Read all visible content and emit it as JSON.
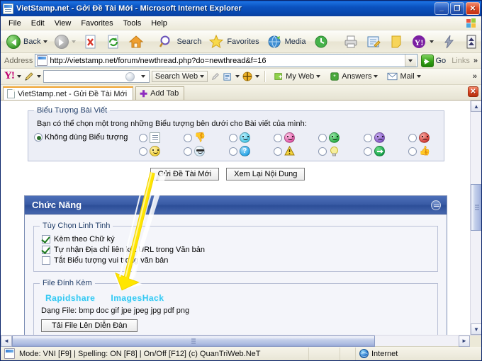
{
  "window": {
    "title": "VietStamp.net - Gởi Đề Tài Mới - Microsoft Internet Explorer",
    "minimize_label": "_",
    "restore_label": "❐",
    "close_label": "✕"
  },
  "menubar": {
    "items": [
      "File",
      "Edit",
      "View",
      "Favorites",
      "Tools",
      "Help"
    ]
  },
  "toolbar": {
    "back_label": "Back",
    "search_label": "Search",
    "favorites_label": "Favorites",
    "media_label": "Media"
  },
  "address": {
    "label": "Address",
    "url": "http://vietstamp.net/forum/newthread.php?do=newthread&f=16",
    "go_label": "Go",
    "links_label": "Links",
    "overflow_label": "»"
  },
  "yahoo_toolbar": {
    "logo": "Y!",
    "search_value": "",
    "search_web_label": "Search Web",
    "my_web_label": "My Web",
    "answers_label": "Answers",
    "mail_label": "Mail",
    "overflow_label": "»"
  },
  "tabs": {
    "active_tab_label": "VietStamp.net - Gửi Đề Tài Mới",
    "add_tab_label": "Add Tab",
    "close_label": "✕"
  },
  "page": {
    "icon_fieldset": {
      "legend": "Biểu Tượng Bài Viết",
      "hint": "Bạn có thể chọn một trong những Biểu tượng bên dưới cho Bài viết của mình:",
      "none_option_label": "Không dùng Biểu tượng",
      "none_selected": true,
      "icons_row1": [
        {
          "name": "note-icon",
          "color": "#ffffff"
        },
        {
          "name": "thumbs-down-icon",
          "color": "#e0453c"
        },
        {
          "name": "cool-smile-icon",
          "color": "#4ec9e8"
        },
        {
          "name": "pink-smile-icon",
          "color": "#e05aa8"
        },
        {
          "name": "green-hat-icon",
          "color": "#2fb24a"
        },
        {
          "name": "purple-sad-icon",
          "color": "#8a5ec9"
        },
        {
          "name": "red-angry-icon",
          "color": "#d8403a"
        }
      ],
      "icons_row2": [
        {
          "name": "yellow-smile-icon",
          "color": "#f2d13b"
        },
        {
          "name": "sunglasses-icon",
          "color": "#cfe6f5"
        },
        {
          "name": "question-icon",
          "color": "#2aa6e8"
        },
        {
          "name": "warning-icon",
          "color": "#f2cc24"
        },
        {
          "name": "lightbulb-icon",
          "color": "#f5e98a"
        },
        {
          "name": "green-arrow-icon",
          "color": "#16a34a"
        },
        {
          "name": "thumbs-up-icon",
          "color": "#f0c33c"
        }
      ]
    },
    "submit_button_label": "Gửi Đề Tài Mới",
    "preview_button_label": "Xem Lại Nội Dung",
    "features_panel": {
      "title": "Chức Năng",
      "options_fieldset": {
        "legend": "Tùy Chọn Linh Tinh",
        "checkboxes": [
          {
            "label": "Kèm theo Chữ ký",
            "checked": true
          },
          {
            "label": "Tự nhận Địa chỉ liên kết URL trong Văn bản",
            "checked": true
          },
          {
            "label": "Tắt Biểu tượng vui trong văn bản",
            "checked": false
          }
        ]
      },
      "attachment_fieldset": {
        "legend": "File Đính Kèm",
        "link_rapidshare": "Rapidshare",
        "link_imageshack": "ImagesHack",
        "filetypes_text": "Dạng File: bmp doc gif jpe jpeg jpg pdf png",
        "upload_button_label": "Tải File Lên Diễn Đàn"
      }
    }
  },
  "annotation": {
    "arrow_color": "#ffe600",
    "arrow_glow": "#ffffff"
  },
  "scrollbars": {
    "up_arrow": "▲",
    "down_arrow": "▼",
    "left_arrow": "◄",
    "right_arrow": "►"
  },
  "statusbar": {
    "message": "Mode: VNI [F9] | Spelling: ON [F8] | On/Off [F12] (c) QuanTriWeb.NeT",
    "zone": "Internet"
  }
}
